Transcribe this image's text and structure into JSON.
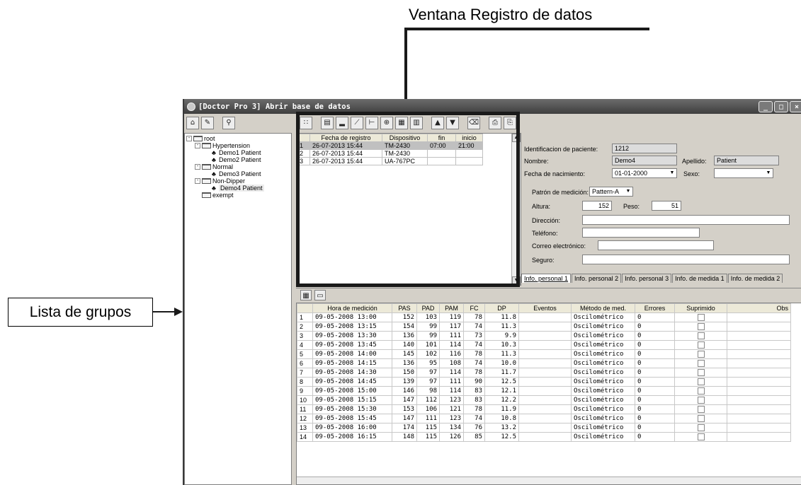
{
  "annotations": {
    "records_window_label": "Ventana Registro de datos",
    "group_list_label": "Lista de grupos"
  },
  "window": {
    "title": "[Doctor Pro 3] Abrir base de datos",
    "controls": [
      "_",
      "□",
      "×"
    ]
  },
  "left_toolbar": [
    "open-db-icon",
    "edit-db-icon",
    "binoculars-icon"
  ],
  "records_toolbar": [
    "grid-icon",
    "list-icon",
    "chart1-icon",
    "chart2-icon",
    "chart3-icon",
    "chart4-icon",
    "chart5-icon",
    "chart6-icon",
    "up-icon",
    "down-icon",
    "eraser-icon",
    "print1-icon",
    "print2-icon"
  ],
  "tree": [
    {
      "label": "root",
      "depth": 0,
      "kind": "folder",
      "expander": "-"
    },
    {
      "label": "Hypertension",
      "depth": 1,
      "kind": "folder",
      "expander": "-"
    },
    {
      "label": "Demo1 Patient",
      "depth": 2,
      "kind": "person"
    },
    {
      "label": "Demo2 Patient",
      "depth": 2,
      "kind": "person"
    },
    {
      "label": "Normal",
      "depth": 1,
      "kind": "folder",
      "expander": "-"
    },
    {
      "label": "Demo3 Patient",
      "depth": 2,
      "kind": "person"
    },
    {
      "label": "Non-Dipper",
      "depth": 1,
      "kind": "folder",
      "expander": "-"
    },
    {
      "label": "Demo4 Patient",
      "depth": 2,
      "kind": "person",
      "selected": true
    },
    {
      "label": "exempt",
      "depth": 1,
      "kind": "folder"
    }
  ],
  "records": {
    "columns": [
      "",
      "Fecha de registro",
      "Dispositivo",
      "fin",
      "inicio"
    ],
    "rows": [
      {
        "n": "1",
        "fecha": "26-07-2013 15:44",
        "dispositivo": "TM-2430",
        "fin": "07:00",
        "inicio": "21:00",
        "selected": true
      },
      {
        "n": "2",
        "fecha": "26-07-2013 15:44",
        "dispositivo": "TM-2430",
        "fin": "",
        "inicio": ""
      },
      {
        "n": "3",
        "fecha": "26-07-2013 15:44",
        "dispositivo": "UA-767PC",
        "fin": "",
        "inicio": ""
      }
    ]
  },
  "patient": {
    "id_label": "Identificacion de paciente:",
    "id_value": "1212",
    "name_label": "Nombre:",
    "name_value": "Demo4",
    "surname_label": "Apellido:",
    "surname_value": "Patient",
    "dob_label": "Fecha de nacimiento:",
    "dob_value": "01-01-2000",
    "sex_label": "Sexo:",
    "sex_value": "",
    "pattern_label": "Patrón de medición:",
    "pattern_value": "Pattern-A",
    "height_label": "Altura:",
    "height_value": "152",
    "weight_label": "Peso:",
    "weight_value": "51",
    "address_label": "Dirección:",
    "phone_label": "Teléfono:",
    "email_label": "Correo electrónico:",
    "insurance_label": "Seguro:",
    "tabs": [
      "Info. personal 1",
      "Info. personal 2",
      "Info. personal 3",
      "Info. de medida 1",
      "Info. de medida 2"
    ],
    "active_tab": 0
  },
  "measurements": {
    "columns": [
      "",
      "Hora de medición",
      "PAS",
      "PAD",
      "PAM",
      "FC",
      "DP",
      "Eventos",
      "Método de med.",
      "Errores",
      "Suprimido",
      "Obs"
    ],
    "rows": [
      [
        "1",
        "09-05-2008 13:00",
        "152",
        "103",
        "119",
        "78",
        "11.8",
        "",
        "Oscilométrico",
        "0"
      ],
      [
        "2",
        "09-05-2008 13:15",
        "154",
        "99",
        "117",
        "74",
        "11.3",
        "",
        "Oscilométrico",
        "0"
      ],
      [
        "3",
        "09-05-2008 13:30",
        "136",
        "99",
        "111",
        "73",
        "9.9",
        "",
        "Oscilométrico",
        "0"
      ],
      [
        "4",
        "09-05-2008 13:45",
        "140",
        "101",
        "114",
        "74",
        "10.3",
        "",
        "Oscilométrico",
        "0"
      ],
      [
        "5",
        "09-05-2008 14:00",
        "145",
        "102",
        "116",
        "78",
        "11.3",
        "",
        "Oscilométrico",
        "0"
      ],
      [
        "6",
        "09-05-2008 14:15",
        "136",
        "95",
        "108",
        "74",
        "10.0",
        "",
        "Oscilométrico",
        "0"
      ],
      [
        "7",
        "09-05-2008 14:30",
        "150",
        "97",
        "114",
        "78",
        "11.7",
        "",
        "Oscilométrico",
        "0"
      ],
      [
        "8",
        "09-05-2008 14:45",
        "139",
        "97",
        "111",
        "90",
        "12.5",
        "",
        "Oscilométrico",
        "0"
      ],
      [
        "9",
        "09-05-2008 15:00",
        "146",
        "98",
        "114",
        "83",
        "12.1",
        "",
        "Oscilométrico",
        "0"
      ],
      [
        "10",
        "09-05-2008 15:15",
        "147",
        "112",
        "123",
        "83",
        "12.2",
        "",
        "Oscilométrico",
        "0"
      ],
      [
        "11",
        "09-05-2008 15:30",
        "153",
        "106",
        "121",
        "78",
        "11.9",
        "",
        "Oscilométrico",
        "0"
      ],
      [
        "12",
        "09-05-2008 15:45",
        "147",
        "111",
        "123",
        "74",
        "10.8",
        "",
        "Oscilométrico",
        "0"
      ],
      [
        "13",
        "09-05-2008 16:00",
        "174",
        "115",
        "134",
        "76",
        "13.2",
        "",
        "Oscilométrico",
        "0"
      ],
      [
        "14",
        "09-05-2008 16:15",
        "148",
        "115",
        "126",
        "85",
        "12.5",
        "",
        "Oscilométrico",
        "0"
      ]
    ]
  }
}
